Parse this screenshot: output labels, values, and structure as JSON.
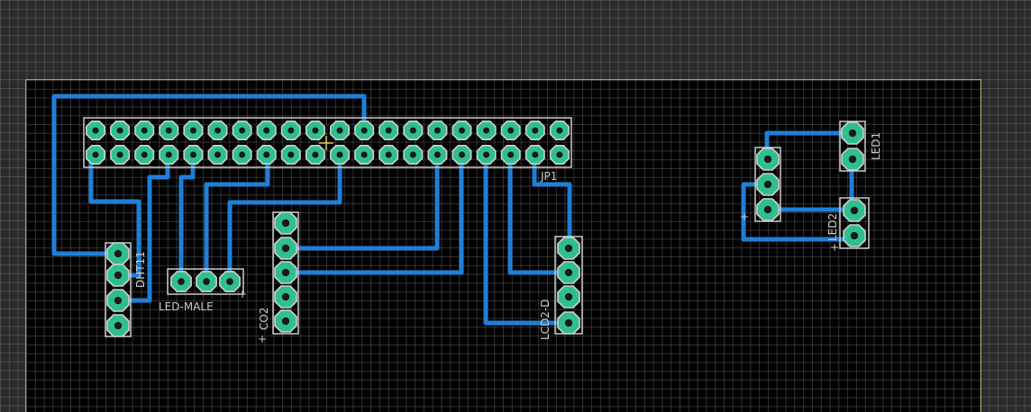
{
  "app": {
    "canvas": "pcb-layout-editor",
    "colors": {
      "background": "#2b2b2b",
      "board": "#000000",
      "board_outline": "#b9a258",
      "trace": "#1f7fd6",
      "pad": "#2fbf8f",
      "silkscreen": "#c8c8c8"
    }
  },
  "labels": {
    "jp1": "JP1",
    "dht11": "DHT11",
    "led_male": "LED-MALE",
    "co2": "CO2",
    "lcd": "LCD2-D",
    "led1": "LED1",
    "led2": "LED2",
    "plus1": "+",
    "plus2": "+",
    "plus3": "+",
    "plus4": "+"
  }
}
